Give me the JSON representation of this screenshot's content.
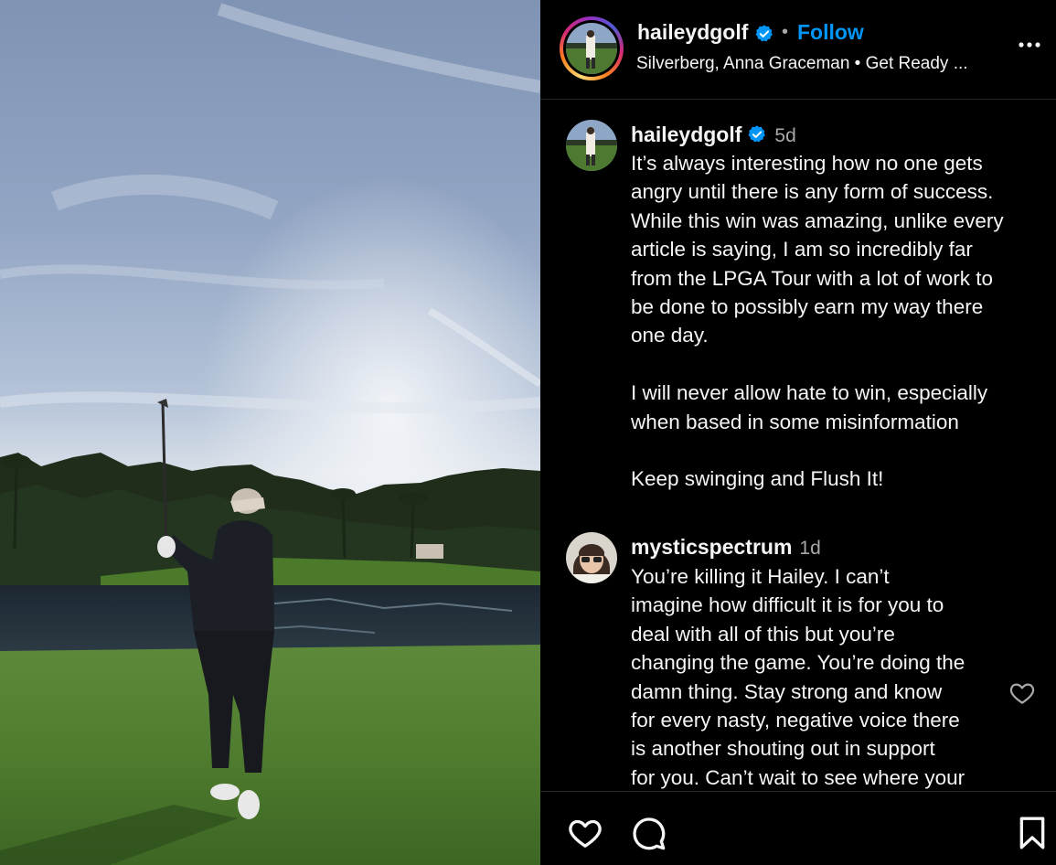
{
  "post": {
    "author": "haileydgolf",
    "follow_label": "Follow",
    "separator": "•",
    "subline": "Silverberg, Anna Graceman • Get Ready ..."
  },
  "icons": {
    "verified": "verified-badge-icon",
    "more": "more-options-icon",
    "like": "heart-icon",
    "comment": "comment-bubble-icon",
    "save": "bookmark-icon"
  },
  "colors": {
    "accent": "#0095f6",
    "background": "#000000",
    "muted": "#a8a8a8",
    "divider": "#262626"
  },
  "caption": {
    "username": "haileydgolf",
    "time": "5d",
    "lines": [
      "It’s always interesting how no one gets",
      "angry until there is any form of success.",
      "While this win was amazing, unlike every",
      "article is saying, I am so incredibly far",
      "from the LPGA Tour with a lot of work to",
      "be done to possibly earn my way there",
      "one day.",
      "",
      "I will never allow hate to win, especially",
      "when based in some misinformation",
      "",
      "Keep swinging and Flush It!"
    ]
  },
  "comments": [
    {
      "username": "mysticspectrum",
      "time": "1d",
      "lines": [
        "You’re killing it Hailey. I can’t",
        "imagine how difficult it is for you to",
        "deal with all of this but you’re",
        "changing the game. You’re doing the",
        "damn thing. Stay strong and know",
        "for every nasty, negative voice there",
        "is another shouting out in support",
        "for you. Can’t wait to see where your"
      ]
    }
  ]
}
